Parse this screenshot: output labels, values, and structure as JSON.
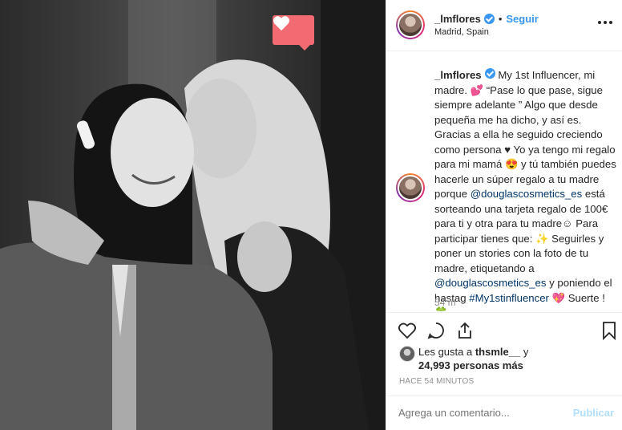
{
  "post": {
    "username": "_lmflores",
    "verified": true,
    "separator": "•",
    "follow_label": "Seguir",
    "location": "Madrid, Spain"
  },
  "caption": {
    "username": "_lmflores",
    "text": "My 1st Influencer, mi madre. 💕 “Pase lo que pase, sigue siempre adelante ” Algo que desde pequeña me ha dicho, y así es. Gracias a ella he seguido creciendo como persona ♥ Yo ya tengo mi regalo para mi mamá 😍 y tú también puedes hacerle un súper regalo a tu madre porque",
    "mention1": "@douglascosmetics_es",
    "text2": " está sorteando una tarjeta regalo de 100€ para ti y otra para tu madre☺ Para participar tienes que: ✨ Seguirles y poner un stories con la foto de tu madre, etiquetando a ",
    "mention2": "@douglascosmetics_es",
    "text3": " y poniendo el hastag ",
    "hashtag": "#My1stinfluencer",
    "text4": " 💖 Suerte ! 🍀",
    "time_ago": "54 m"
  },
  "likes": {
    "prefix": "Les gusta a ",
    "first_user": "thsmle__",
    "connector": " y",
    "count_text": "24,993 personas más"
  },
  "timestamp": "HACE 54 MINUTOS",
  "comment_box": {
    "placeholder": "Agrega un comentario...",
    "publish_label": "Publicar"
  },
  "colors": {
    "accent": "#3897f0",
    "like_badge": "#f26b73",
    "mention": "#003569"
  }
}
